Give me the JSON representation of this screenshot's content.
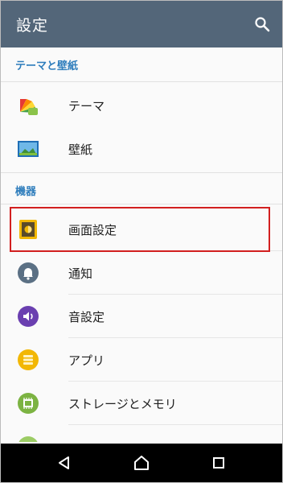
{
  "appbar": {
    "title": "設定",
    "search_icon": "search-icon"
  },
  "sections": [
    {
      "header": "テーマと壁紙"
    },
    {
      "header": "機器"
    }
  ],
  "items": {
    "theme": {
      "label": "テーマ",
      "icon": "palette-icon"
    },
    "wallpaper": {
      "label": "壁紙",
      "icon": "picture-icon"
    },
    "display": {
      "label": "画面設定",
      "icon": "display-icon",
      "highlighted": true
    },
    "notifications": {
      "label": "通知",
      "icon": "bell-icon"
    },
    "sound": {
      "label": "音設定",
      "icon": "speaker-icon"
    },
    "apps": {
      "label": "アプリ",
      "icon": "apps-icon"
    },
    "storage": {
      "label": "ストレージとメモリ",
      "icon": "memory-icon"
    }
  },
  "navbar": {
    "back": "back-icon",
    "home": "home-icon",
    "recents": "recents-icon"
  },
  "colors": {
    "appbar": "#536679",
    "section_header": "#2e7dbc",
    "highlight_border": "#d21f1f",
    "navbar": "#000000"
  }
}
